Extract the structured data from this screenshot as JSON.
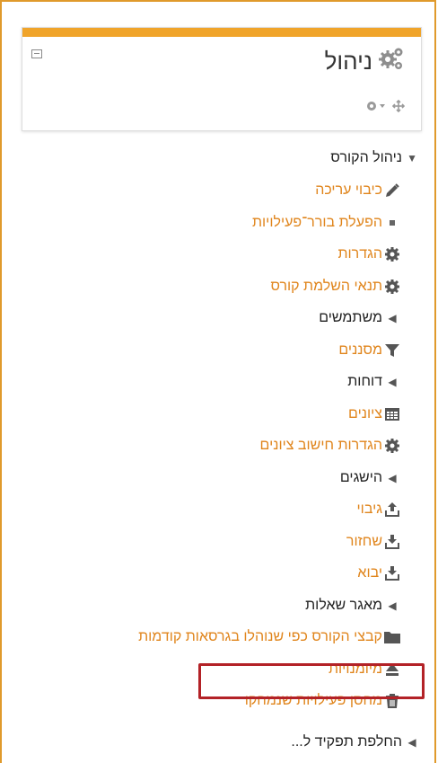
{
  "block": {
    "title": "ניהול",
    "colors": {
      "accent": "#f0a42a",
      "link": "#e0851c"
    }
  },
  "tree": {
    "course_admin": "ניהול הקורס",
    "items": [
      {
        "label": "כיבוי עריכה",
        "icon": "pencil-icon",
        "type": "link"
      },
      {
        "label": "הפעלת בורר־פעילויות",
        "icon": "bullet-icon",
        "type": "link"
      },
      {
        "label": "הגדרות",
        "icon": "gear-icon",
        "type": "link"
      },
      {
        "label": "תנאי השלמת קורס",
        "icon": "gear-icon",
        "type": "link"
      },
      {
        "label": "משתמשים",
        "icon": "caret-left-icon",
        "type": "branch"
      },
      {
        "label": "מסננים",
        "icon": "filter-icon",
        "type": "link"
      },
      {
        "label": "דוחות",
        "icon": "caret-left-icon",
        "type": "branch"
      },
      {
        "label": "ציונים",
        "icon": "table-icon",
        "type": "link"
      },
      {
        "label": "הגדרות חישוב ציונים",
        "icon": "gear-icon",
        "type": "link"
      },
      {
        "label": "הישגים",
        "icon": "caret-left-icon",
        "type": "branch"
      },
      {
        "label": "גיבוי",
        "icon": "upload-icon",
        "type": "link"
      },
      {
        "label": "שחזור",
        "icon": "download-icon",
        "type": "link"
      },
      {
        "label": "יבוא",
        "icon": "download-icon",
        "type": "link"
      },
      {
        "label": "מאגר שאלות",
        "icon": "caret-left-icon",
        "type": "branch"
      },
      {
        "label": "קבצי הקורס כפי שנוהלו בגרסאות קודמות",
        "icon": "folder-icon",
        "type": "link"
      },
      {
        "label": "מיומנויות",
        "icon": "eject-icon",
        "type": "link"
      },
      {
        "label": "מחסן פעילויות שנמחקו",
        "icon": "trash-icon",
        "type": "link"
      }
    ],
    "switch_role": "החלפת תפקיד ל..."
  }
}
